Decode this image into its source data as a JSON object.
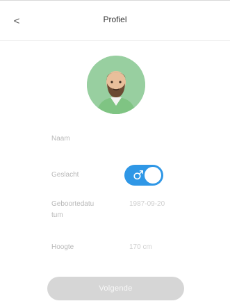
{
  "header": {
    "back_icon": "chevron-left-icon",
    "back_glyph": "<",
    "title": "Profiel"
  },
  "profile": {
    "avatar_icon": "bearded-man-avatar-icon",
    "name_label": "Naam",
    "gender_label": "Geslacht",
    "gender_toggle_on": true,
    "gender_toggle_glyph": "♂",
    "birthdate_label_line1": "Geboortedatu",
    "birthdate_label_line2": "tum",
    "birthdate_value": "1987-09-20",
    "height_label": "Hoogte",
    "height_value": "170 cm"
  },
  "actions": {
    "save_label": "Volgende"
  },
  "colors": {
    "accent": "#2f97e6",
    "avatar_bg": "#98cfa0",
    "button_bg": "#d6d6d6"
  }
}
